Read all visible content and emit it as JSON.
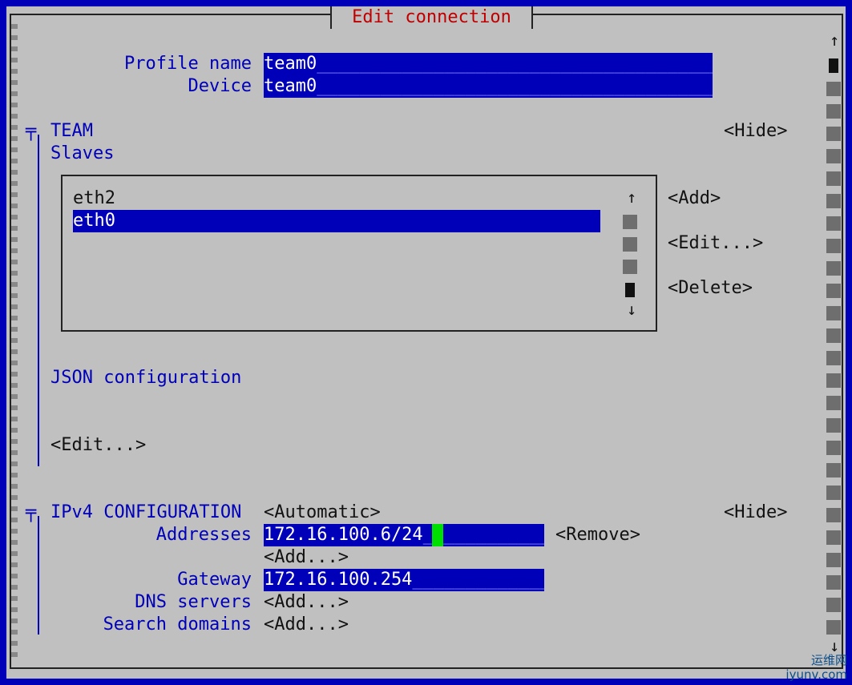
{
  "dialog": {
    "title": "Edit connection"
  },
  "profile": {
    "profile_name_label": "Profile name",
    "profile_name_value": "team0",
    "device_label": "Device",
    "device_value": "team0"
  },
  "team": {
    "toggle": "╤",
    "title": "TEAM",
    "hide_label": "<Hide>",
    "slaves_label": "Slaves",
    "slaves": [
      {
        "name": "eth2",
        "selected": false
      },
      {
        "name": "eth0",
        "selected": true
      }
    ],
    "add_label": "<Add>",
    "edit_label": "<Edit...>",
    "delete_label": "<Delete>",
    "json_label": "JSON configuration",
    "json_edit_label": "<Edit...>"
  },
  "ipv4": {
    "toggle": "╤",
    "title": "IPv4 CONFIGURATION",
    "mode": "<Automatic>",
    "hide_label": "<Hide>",
    "addresses_label": "Addresses",
    "address_value": "172.16.100.6/24",
    "remove_label": "<Remove>",
    "add_address_label": "<Add...>",
    "gateway_label": "Gateway",
    "gateway_value": "172.16.100.254",
    "dns_label": "DNS servers",
    "dns_add_label": "<Add...>",
    "search_label": "Search domains",
    "search_add_label": "<Add...>"
  },
  "scroll": {
    "up_arrow": "↑",
    "down_arrow": "↓"
  },
  "watermark": {
    "line1": "运维网",
    "line2": "iyunv.com"
  },
  "colors": {
    "field_bg": "#0000b8",
    "title": "#c00000",
    "screen_bg": "#c0c0c0",
    "cursor": "#00e000"
  }
}
